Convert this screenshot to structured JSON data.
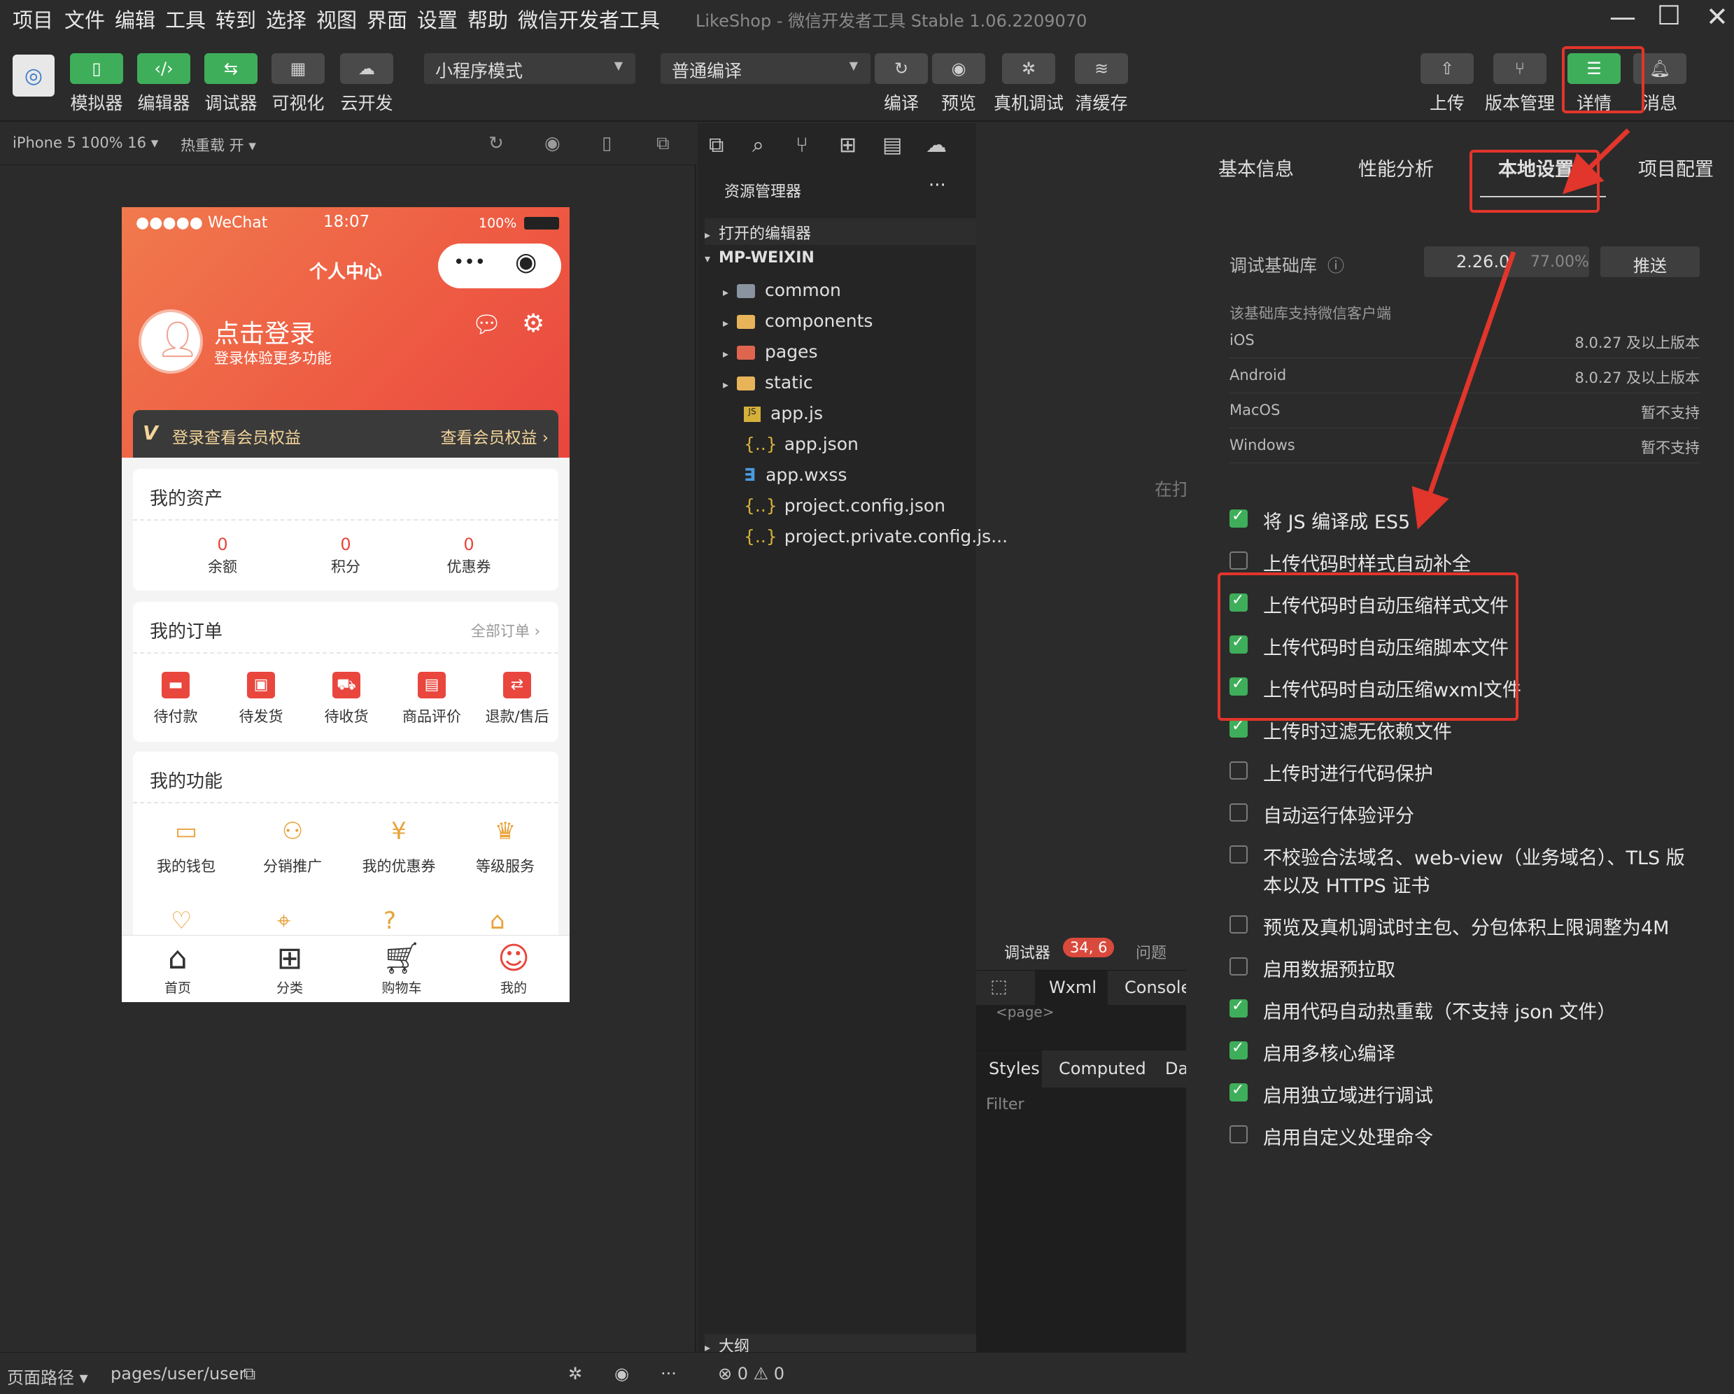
{
  "menubar": {
    "items": [
      "项目",
      "文件",
      "编辑",
      "工具",
      "转到",
      "选择",
      "视图",
      "界面",
      "设置",
      "帮助",
      "微信开发者工具"
    ],
    "title": "LikeShop - 微信开发者工具 Stable 1.06.2209070"
  },
  "toolbar": {
    "left_buttons": [
      {
        "label": "模拟器",
        "icon": "phone-icon"
      },
      {
        "label": "编辑器",
        "icon": "code-icon"
      },
      {
        "label": "调试器",
        "icon": "debug-icon"
      },
      {
        "label": "可视化",
        "icon": "layout-icon"
      },
      {
        "label": "云开发",
        "icon": "cloud-icon"
      }
    ],
    "mode_select": "小程序模式",
    "compile_select": "普通编译",
    "mid_buttons": [
      "编译",
      "预览",
      "真机调试",
      "清缓存"
    ],
    "right_buttons": [
      "上传",
      "版本管理",
      "详情",
      "消息"
    ]
  },
  "simulator": {
    "device": "iPhone 5 100% 16 ▾",
    "hot_reload": "热重载 开 ▾",
    "phone": {
      "status_signal": "●●●●● WeChat",
      "status_time": "18:07",
      "status_battery": "100%",
      "nav_title": "个人中心",
      "login_title": "点击登录",
      "login_sub": "登录体验更多功能",
      "vip_left": "登录查看会员权益",
      "vip_right": "查看会员权益 ›",
      "assets": {
        "title": "我的资产",
        "stats": [
          {
            "value": "0",
            "label": "余额"
          },
          {
            "value": "0",
            "label": "积分"
          },
          {
            "value": "0",
            "label": "优惠券"
          }
        ]
      },
      "orders": {
        "title": "我的订单",
        "all": "全部订单 ›",
        "items": [
          "待付款",
          "待发货",
          "待收货",
          "商品评价",
          "退款/售后"
        ]
      },
      "features": {
        "title": "我的功能",
        "items": [
          "我的钱包",
          "分销推广",
          "我的优惠券",
          "等级服务"
        ]
      },
      "tabs": [
        "首页",
        "分类",
        "购物车",
        "我的"
      ]
    }
  },
  "explorer": {
    "title": "资源管理器",
    "open_editors": "打开的编辑器",
    "root": "MP-WEIXIN",
    "items": [
      {
        "name": "common",
        "type": "folder"
      },
      {
        "name": "components",
        "type": "folder"
      },
      {
        "name": "pages",
        "type": "folder"
      },
      {
        "name": "static",
        "type": "folder"
      },
      {
        "name": "app.js",
        "type": "js"
      },
      {
        "name": "app.json",
        "type": "json"
      },
      {
        "name": "app.wxss",
        "type": "css"
      },
      {
        "name": "project.config.json",
        "type": "json"
      },
      {
        "name": "project.private.config.js...",
        "type": "json"
      }
    ],
    "outline": "大纲",
    "errors": "⊗ 0 ⚠ 0"
  },
  "editor_hint": "在打",
  "debugger": {
    "tab": "调试器",
    "badge": "34, 6",
    "issues": "问题",
    "wxml": "Wxml",
    "console": "Console",
    "page_tag": "<page>",
    "styles": "Styles",
    "computed": "Computed",
    "da": "Da",
    "filter": "Filter"
  },
  "details": {
    "tabs": [
      "基本信息",
      "性能分析",
      "本地设置",
      "项目配置"
    ],
    "base_lib_label": "调试基础库",
    "base_lib_version": "2.26.0",
    "base_lib_percent": "77.00%",
    "push": "推送",
    "support_note": "该基础库支持微信客户端",
    "platforms": [
      {
        "k": "iOS",
        "v": "8.0.27 及以上版本"
      },
      {
        "k": "Android",
        "v": "8.0.27 及以上版本"
      },
      {
        "k": "MacOS",
        "v": "暂不支持"
      },
      {
        "k": "Windows",
        "v": "暂不支持"
      }
    ],
    "options": [
      {
        "label": "将 JS 编译成 ES5",
        "checked": true
      },
      {
        "label": "上传代码时样式自动补全",
        "checked": false
      },
      {
        "label": "上传代码时自动压缩样式文件",
        "checked": true
      },
      {
        "label": "上传代码时自动压缩脚本文件",
        "checked": true
      },
      {
        "label": "上传代码时自动压缩wxml文件",
        "checked": true
      },
      {
        "label": "上传时过滤无依赖文件",
        "checked": true
      },
      {
        "label": "上传时进行代码保护",
        "checked": false
      },
      {
        "label": "自动运行体验评分",
        "checked": false
      },
      {
        "label": "不校验合法域名、web-view（业务域名）、TLS 版",
        "label2": "本以及 HTTPS 证书",
        "checked": false
      },
      {
        "label": "预览及真机调试时主包、分包体积上限调整为4M",
        "checked": false
      },
      {
        "label": "启用数据预拉取",
        "checked": false
      },
      {
        "label": "启用代码自动热重载（不支持 json 文件）",
        "checked": true
      },
      {
        "label": "启用多核心编译",
        "checked": true
      },
      {
        "label": "启用独立域进行调试",
        "checked": true
      },
      {
        "label": "启用自定义处理命令",
        "checked": false
      }
    ]
  },
  "statusbar": {
    "path_label": "页面路径 ▾",
    "path": "pages/user/user"
  },
  "colors": {
    "accent_green": "#3fae5a",
    "annotation_red": "#e2352b",
    "brand_red": "#e9463e"
  }
}
